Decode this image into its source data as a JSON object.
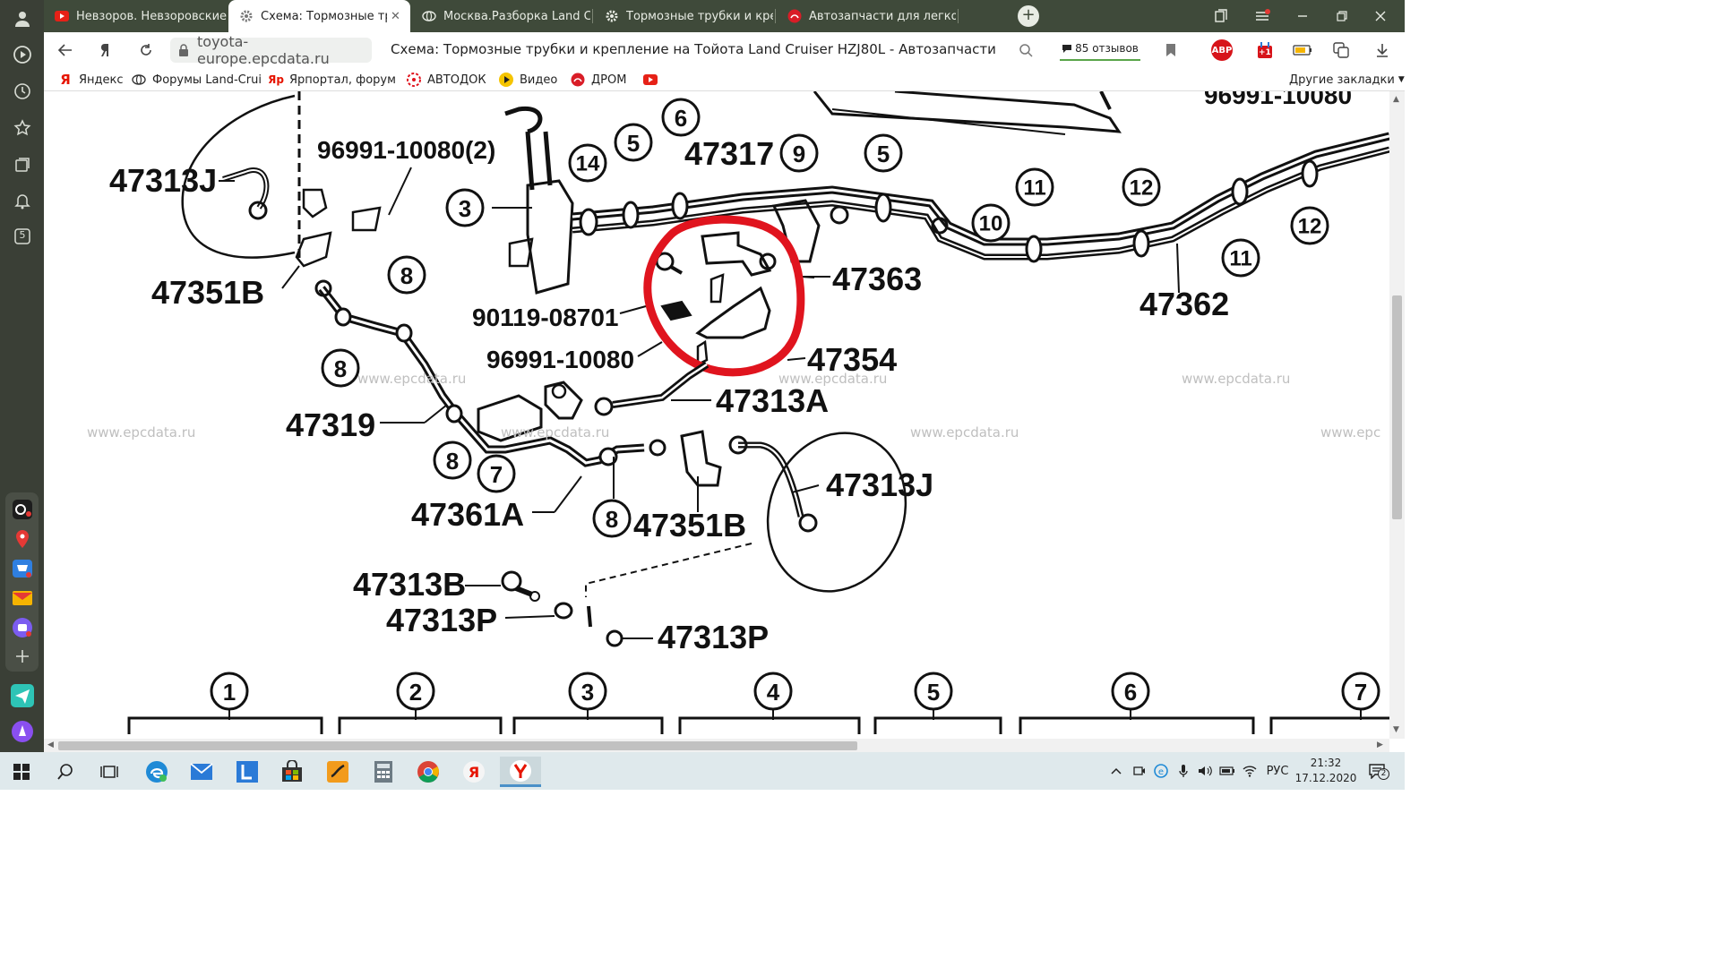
{
  "browser": {
    "tabs": [
      {
        "title": "Невзоров. Невзоровские",
        "favicon": "youtube-icon"
      },
      {
        "title": "Схема: Тормозные труб",
        "favicon": "gear-icon",
        "active": true
      },
      {
        "title": "Москва.Разборка Land Cr",
        "favicon": "toyota-icon"
      },
      {
        "title": "Тормозные трубки и креп",
        "favicon": "gear-icon"
      },
      {
        "title": "Автозапчасти для легковы",
        "favicon": "drom-icon"
      }
    ],
    "toolbar": {
      "url": "toyota-europe.epcdata.ru",
      "page_title": "Схема: Тормозные трубки и крепление на Тойота Land Cruiser HZJ80L - Автозапчасти",
      "reviews": "85 отзывов",
      "abp_label": "ABP",
      "notif_label": "+1"
    },
    "bookmarks": [
      {
        "label": "Яндекс",
        "icon": "yandex-icon"
      },
      {
        "label": "Форумы Land-Crui",
        "icon": "toyota-icon"
      },
      {
        "label": "Ярпортал, форум",
        "icon": "yar-icon"
      },
      {
        "label": "АВТОДОК",
        "icon": "autodoc-icon"
      },
      {
        "label": "Видео",
        "icon": "video-icon"
      },
      {
        "label": "ДРОМ",
        "icon": "drom-icon"
      },
      {
        "label": "",
        "icon": "youtube-icon"
      }
    ],
    "other_bookmarks": "Другие закладки",
    "sidebar_counter": "5"
  },
  "diagram": {
    "watermark": "www.epcdata.ru",
    "watermark_partial": "www.epc",
    "top_right_partial": "96991-10080",
    "part_numbers": {
      "p47313J_top": "47313J",
      "p96991_2": "96991-10080(2)",
      "p47351B_left": "47351B",
      "p47317": "47317",
      "p47363": "47363",
      "p47362": "47362",
      "p90119": "90119-08701",
      "p96991": "96991-10080",
      "p47354": "47354",
      "p47313A": "47313A",
      "p47319": "47319",
      "p47361A": "47361A",
      "p47351B_bottom": "47351B",
      "p47313J_bottom": "47313J",
      "p47313B": "47313B",
      "p47313P_left": "47313P",
      "p47313P_right": "47313P"
    },
    "callouts": {
      "c3": "3",
      "c14": "14",
      "c5a": "5",
      "c6": "6",
      "c9": "9",
      "c5b": "5",
      "c11a": "11",
      "c12a": "12",
      "c10": "10",
      "c11b": "11",
      "c12b": "12",
      "c8a": "8",
      "c8b": "8",
      "c8c": "8",
      "c7": "7",
      "c8d": "8"
    },
    "table_headers": [
      "1",
      "2",
      "3",
      "4",
      "5",
      "6",
      "7"
    ]
  },
  "taskbar": {
    "tray_lang": "РУС",
    "time": "21:32",
    "date": "17.12.2020",
    "notifications": "2"
  },
  "colors": {
    "tabbar": "#3f4a3a",
    "sidebar": "#3a3f36",
    "highlight_circle": "#e0141e",
    "taskbar": "#dfe9ec"
  }
}
